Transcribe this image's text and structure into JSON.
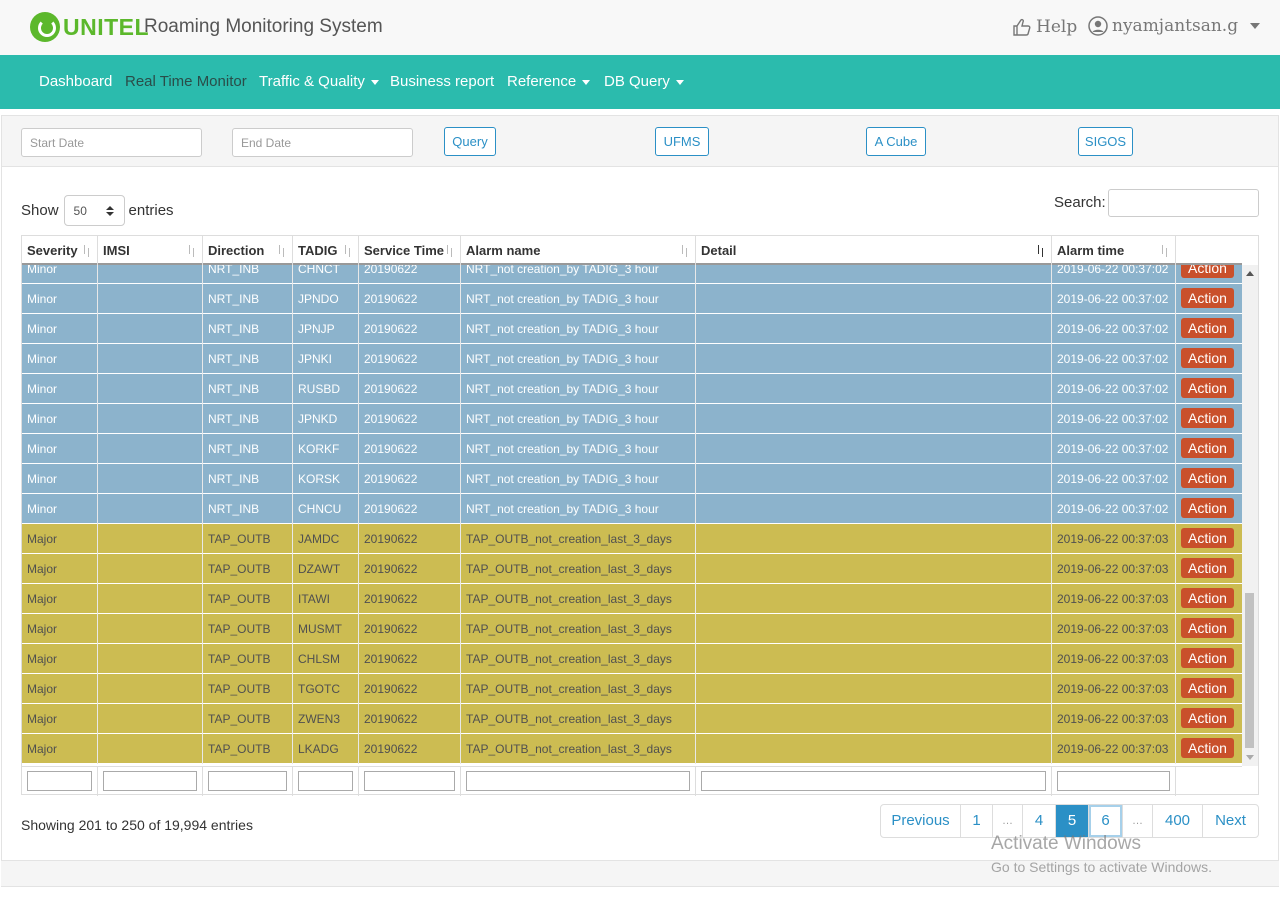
{
  "header": {
    "logo_text": "UNITEL",
    "app_title": "Roaming Monitoring System",
    "help_label": "Help",
    "user_name": "nyamjantsan.g"
  },
  "nav": {
    "items": [
      {
        "label": "Dashboard"
      },
      {
        "label": "Real Time Monitor"
      },
      {
        "label": "Traffic & Quality"
      },
      {
        "label": "Business report"
      },
      {
        "label": "Reference"
      },
      {
        "label": "DB Query"
      }
    ]
  },
  "filters": {
    "start_date_placeholder": "Start Date",
    "end_date_placeholder": "End Date",
    "buttons": [
      "Query",
      "UFMS",
      "A Cube",
      "SIGOS"
    ]
  },
  "table_controls": {
    "show_label": "Show",
    "page_size": "50",
    "entries_label": "entries",
    "search_label": "Search:"
  },
  "columns": [
    "Severity",
    "IMSI",
    "Direction",
    "TADIG",
    "Service Time",
    "Alarm name",
    "Detail",
    "Alarm time",
    ""
  ],
  "rows": [
    {
      "sev": "Minor",
      "imsi": "",
      "dir": "NRT_INB",
      "tadig": "CHNCT",
      "svc": "20190622",
      "alarm": "NRT_not creation_by TADIG_3 hour",
      "detail": "",
      "time": "2019-06-22 00:37:02",
      "action": "Action"
    },
    {
      "sev": "Minor",
      "imsi": "",
      "dir": "NRT_INB",
      "tadig": "JPNDO",
      "svc": "20190622",
      "alarm": "NRT_not creation_by TADIG_3 hour",
      "detail": "",
      "time": "2019-06-22 00:37:02",
      "action": "Action"
    },
    {
      "sev": "Minor",
      "imsi": "",
      "dir": "NRT_INB",
      "tadig": "JPNJP",
      "svc": "20190622",
      "alarm": "NRT_not creation_by TADIG_3 hour",
      "detail": "",
      "time": "2019-06-22 00:37:02",
      "action": "Action"
    },
    {
      "sev": "Minor",
      "imsi": "",
      "dir": "NRT_INB",
      "tadig": "JPNKI",
      "svc": "20190622",
      "alarm": "NRT_not creation_by TADIG_3 hour",
      "detail": "",
      "time": "2019-06-22 00:37:02",
      "action": "Action"
    },
    {
      "sev": "Minor",
      "imsi": "",
      "dir": "NRT_INB",
      "tadig": "RUSBD",
      "svc": "20190622",
      "alarm": "NRT_not creation_by TADIG_3 hour",
      "detail": "",
      "time": "2019-06-22 00:37:02",
      "action": "Action"
    },
    {
      "sev": "Minor",
      "imsi": "",
      "dir": "NRT_INB",
      "tadig": "JPNKD",
      "svc": "20190622",
      "alarm": "NRT_not creation_by TADIG_3 hour",
      "detail": "",
      "time": "2019-06-22 00:37:02",
      "action": "Action"
    },
    {
      "sev": "Minor",
      "imsi": "",
      "dir": "NRT_INB",
      "tadig": "KORKF",
      "svc": "20190622",
      "alarm": "NRT_not creation_by TADIG_3 hour",
      "detail": "",
      "time": "2019-06-22 00:37:02",
      "action": "Action"
    },
    {
      "sev": "Minor",
      "imsi": "",
      "dir": "NRT_INB",
      "tadig": "KORSK",
      "svc": "20190622",
      "alarm": "NRT_not creation_by TADIG_3 hour",
      "detail": "",
      "time": "2019-06-22 00:37:02",
      "action": "Action"
    },
    {
      "sev": "Minor",
      "imsi": "",
      "dir": "NRT_INB",
      "tadig": "CHNCU",
      "svc": "20190622",
      "alarm": "NRT_not creation_by TADIG_3 hour",
      "detail": "",
      "time": "2019-06-22 00:37:02",
      "action": "Action"
    },
    {
      "sev": "Major",
      "imsi": "",
      "dir": "TAP_OUTB",
      "tadig": "JAMDC",
      "svc": "20190622",
      "alarm": "TAP_OUTB_not_creation_last_3_days",
      "detail": "",
      "time": "2019-06-22 00:37:03",
      "action": "Action"
    },
    {
      "sev": "Major",
      "imsi": "",
      "dir": "TAP_OUTB",
      "tadig": "DZAWT",
      "svc": "20190622",
      "alarm": "TAP_OUTB_not_creation_last_3_days",
      "detail": "",
      "time": "2019-06-22 00:37:03",
      "action": "Action"
    },
    {
      "sev": "Major",
      "imsi": "",
      "dir": "TAP_OUTB",
      "tadig": "ITAWI",
      "svc": "20190622",
      "alarm": "TAP_OUTB_not_creation_last_3_days",
      "detail": "",
      "time": "2019-06-22 00:37:03",
      "action": "Action"
    },
    {
      "sev": "Major",
      "imsi": "",
      "dir": "TAP_OUTB",
      "tadig": "MUSMT",
      "svc": "20190622",
      "alarm": "TAP_OUTB_not_creation_last_3_days",
      "detail": "",
      "time": "2019-06-22 00:37:03",
      "action": "Action"
    },
    {
      "sev": "Major",
      "imsi": "",
      "dir": "TAP_OUTB",
      "tadig": "CHLSM",
      "svc": "20190622",
      "alarm": "TAP_OUTB_not_creation_last_3_days",
      "detail": "",
      "time": "2019-06-22 00:37:03",
      "action": "Action"
    },
    {
      "sev": "Major",
      "imsi": "",
      "dir": "TAP_OUTB",
      "tadig": "TGOTC",
      "svc": "20190622",
      "alarm": "TAP_OUTB_not_creation_last_3_days",
      "detail": "",
      "time": "2019-06-22 00:37:03",
      "action": "Action"
    },
    {
      "sev": "Major",
      "imsi": "",
      "dir": "TAP_OUTB",
      "tadig": "ZWEN3",
      "svc": "20190622",
      "alarm": "TAP_OUTB_not_creation_last_3_days",
      "detail": "",
      "time": "2019-06-22 00:37:03",
      "action": "Action"
    },
    {
      "sev": "Major",
      "imsi": "",
      "dir": "TAP_OUTB",
      "tadig": "LKADG",
      "svc": "20190622",
      "alarm": "TAP_OUTB_not_creation_last_3_days",
      "detail": "",
      "time": "2019-06-22 00:37:03",
      "action": "Action"
    }
  ],
  "info_text": "Showing 201 to 250 of 19,994 entries",
  "pagination": {
    "items": [
      "Previous",
      "1",
      "…",
      "4",
      "5",
      "6",
      "…",
      "400",
      "Next"
    ],
    "active": "5"
  },
  "watermark": {
    "line1": "Activate Windows",
    "line2": "Go to Settings to activate Windows."
  },
  "colors": {
    "navbar": "#2bbbad",
    "minor_row": "#8cb3cc",
    "major_row": "#ccbc52",
    "action_button": "#c9502b",
    "link": "#2b90c6",
    "logo": "#5cb82c"
  }
}
